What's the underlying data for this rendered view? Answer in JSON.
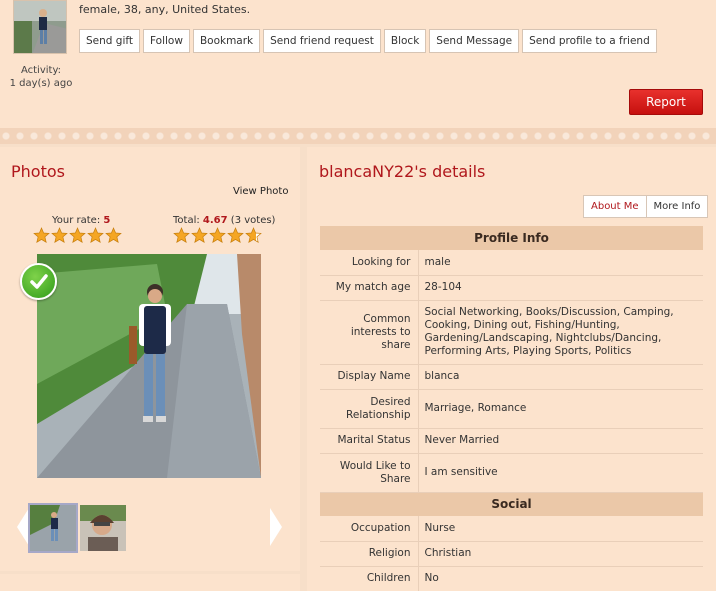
{
  "profile": {
    "summary": "female, 38, any, United States.",
    "activity_label": "Activity:",
    "activity_value": "1 day(s) ago",
    "actions": [
      "Send gift",
      "Follow",
      "Bookmark",
      "Send friend request",
      "Block",
      "Send Message",
      "Send profile to a friend"
    ],
    "report_label": "Report"
  },
  "photos": {
    "title": "Photos",
    "view_photo": "View Photo",
    "your_rate_label": "Your rate:",
    "your_rate_value": "5",
    "total_label": "Total:",
    "total_value": "4.67",
    "total_votes": "(3 votes)",
    "your_rate_stars": 5,
    "total_stars": 4.67
  },
  "details": {
    "title": "blancaNY22's details",
    "tabs": [
      "About Me",
      "More Info"
    ],
    "section_profile": "Profile Info",
    "section_social": "Social",
    "profile_rows": [
      {
        "k": "Looking for",
        "v": "male"
      },
      {
        "k": "My match age",
        "v": "28-104"
      },
      {
        "k": "Common interests to share",
        "v": "Social Networking, Books/Discussion, Camping, Cooking, Dining out, Fishing/Hunting, Gardening/Landscaping, Nightclubs/Dancing, Performing Arts, Playing Sports, Politics"
      },
      {
        "k": "Display Name",
        "v": "blanca"
      },
      {
        "k": "Desired Relationship",
        "v": "Marriage, Romance"
      },
      {
        "k": "Marital Status",
        "v": "Never Married"
      },
      {
        "k": "Would Like to Share",
        "v": "I am sensitive"
      }
    ],
    "social_rows": [
      {
        "k": "Occupation",
        "v": "Nurse"
      },
      {
        "k": "Religion",
        "v": "Christian"
      },
      {
        "k": "Children",
        "v": "No"
      }
    ]
  },
  "colors": {
    "accent": "#b0171c",
    "report": "#d41f1c",
    "star": "#f5a623"
  }
}
